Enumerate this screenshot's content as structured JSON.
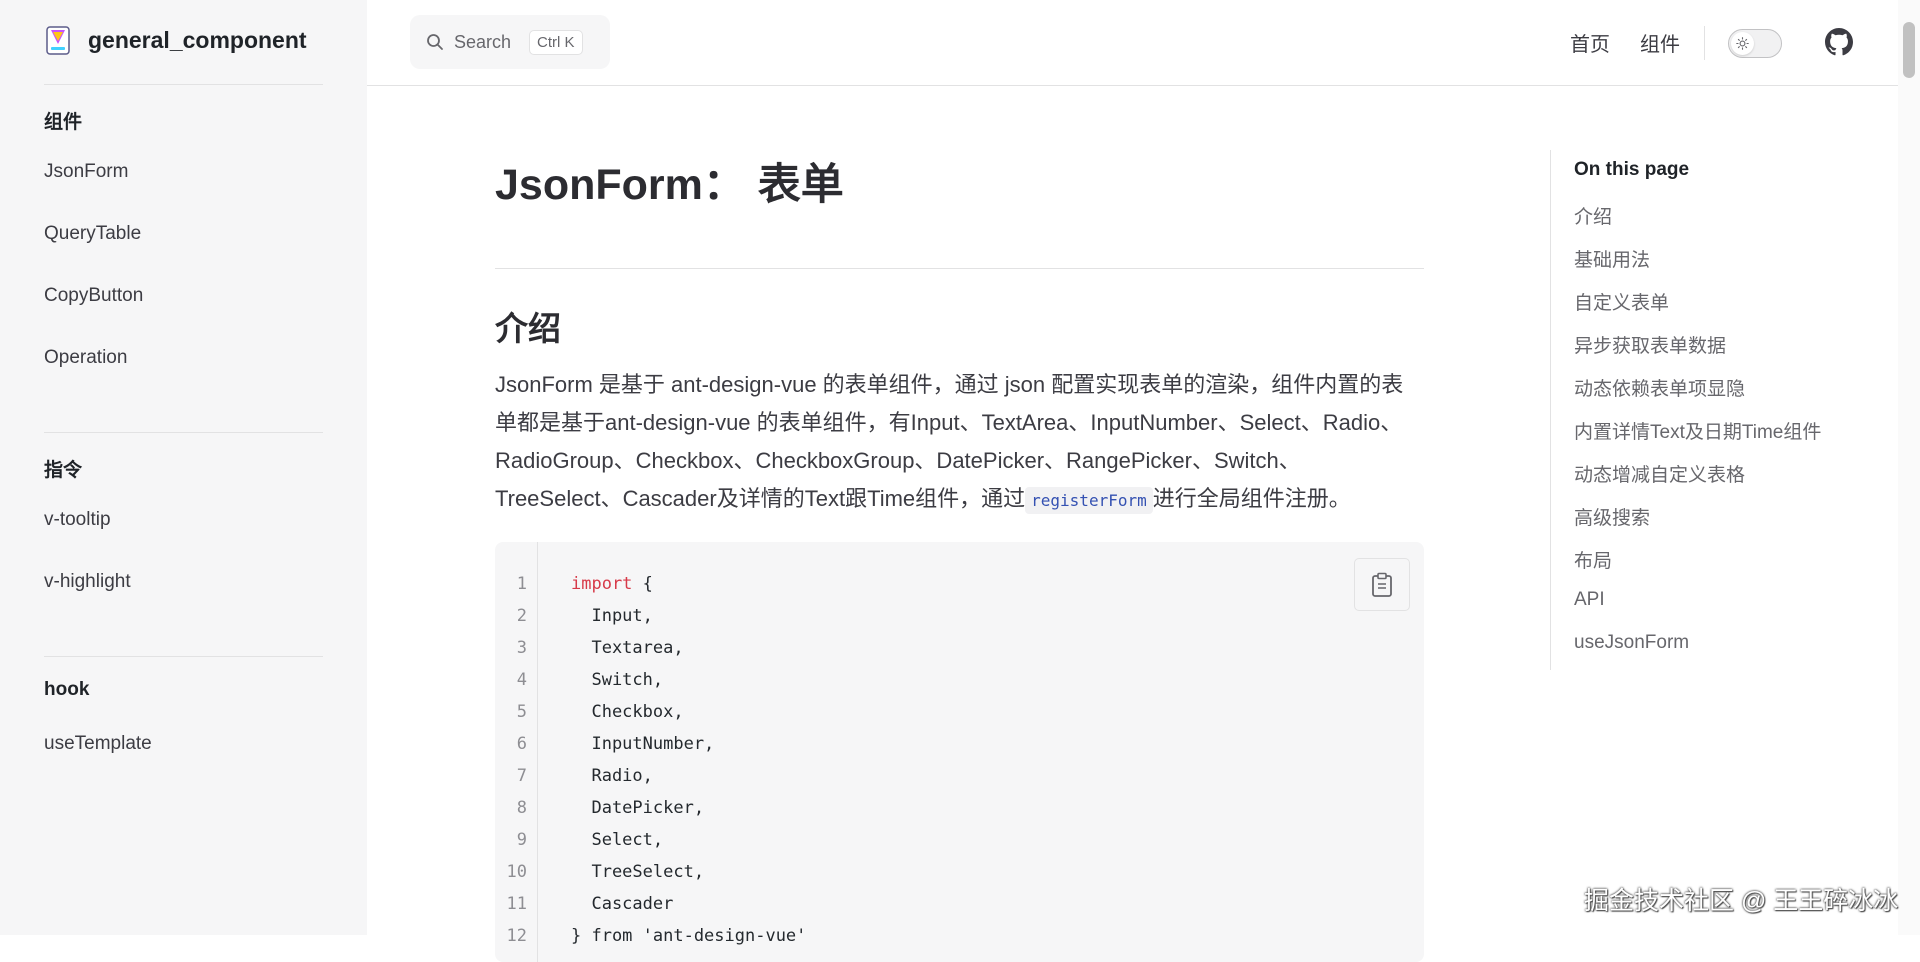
{
  "brand": {
    "title": "general_component"
  },
  "search": {
    "label": "Search",
    "shortcut": "Ctrl K"
  },
  "nav": {
    "home": "首页",
    "components": "组件"
  },
  "sidebar": {
    "groups": [
      {
        "title": "组件",
        "items": [
          "JsonForm",
          "QueryTable",
          "CopyButton",
          "Operation"
        ]
      },
      {
        "title": "指令",
        "items": [
          "v-tooltip",
          "v-highlight"
        ]
      },
      {
        "title": "hook",
        "items": [
          "useTemplate"
        ]
      }
    ]
  },
  "content": {
    "title": "JsonForm： 表单",
    "section_title": "介绍",
    "intro_before": "JsonForm 是基于 ant-design-vue 的表单组件，通过 json 配置实现表单的渲染，组件内置的表单都是基于ant-design-vue 的表单组件，有Input、TextArea、InputNumber、Select、Radio、RadioGroup、Checkbox、CheckboxGroup、DatePicker、RangePicker、Switch、TreeSelect、Cascader及详情的Text跟Time组件，通过",
    "intro_code": "registerForm",
    "intro_after": "进行全局组件注册。"
  },
  "code": {
    "line_numbers": [
      "1",
      "2",
      "3",
      "4",
      "5",
      "6",
      "7",
      "8",
      "9",
      "10",
      "11",
      "12"
    ],
    "lines": [
      {
        "kw": "import",
        "text": " {"
      },
      {
        "kw": "",
        "text": "  Input,"
      },
      {
        "kw": "",
        "text": "  Textarea,"
      },
      {
        "kw": "",
        "text": "  Switch,"
      },
      {
        "kw": "",
        "text": "  Checkbox,"
      },
      {
        "kw": "",
        "text": "  InputNumber,"
      },
      {
        "kw": "",
        "text": "  Radio,"
      },
      {
        "kw": "",
        "text": "  DatePicker,"
      },
      {
        "kw": "",
        "text": "  Select,"
      },
      {
        "kw": "",
        "text": "  TreeSelect,"
      },
      {
        "kw": "",
        "text": "  Cascader"
      },
      {
        "kw": "",
        "text": "} from 'ant-design-vue'"
      }
    ]
  },
  "outline": {
    "title": "On this page",
    "items": [
      "介绍",
      "基础用法",
      "自定义表单",
      "异步获取表单数据",
      "动态依赖表单项显隐",
      "内置详情Text及日期Time组件",
      "动态增减自定义表格",
      "高级搜索",
      "布局",
      "API",
      "useJsonForm"
    ]
  },
  "watermark": "掘金技术社区 @ 王王碎冰冰",
  "colors": {
    "accent": "#3451b2",
    "keyword": "#d73a49",
    "sidebar_bg": "#f6f6f7"
  }
}
